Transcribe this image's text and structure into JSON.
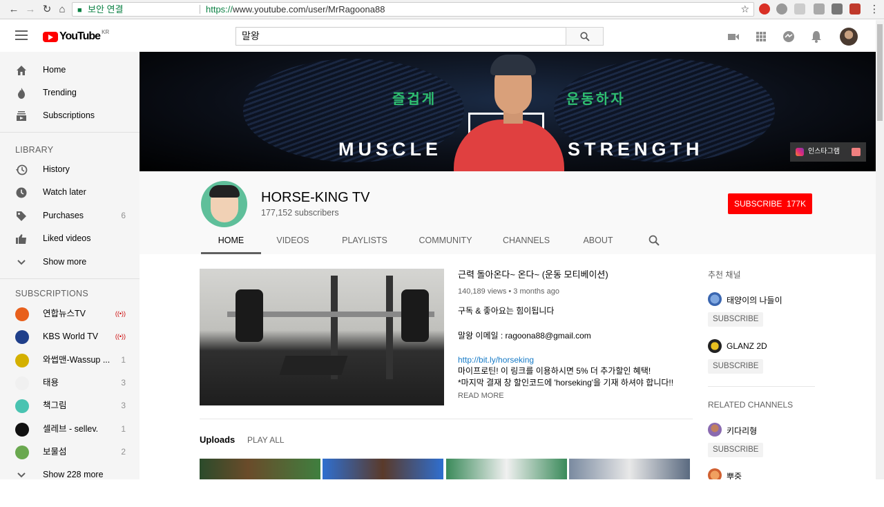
{
  "browser": {
    "security_label": "보안 연결",
    "url_scheme": "https://",
    "url_rest": "www.youtube.com/user/MrRagoona88"
  },
  "header": {
    "logo_text": "YouTube",
    "logo_region": "KR",
    "search_value": "말왕"
  },
  "sidebar": {
    "nav": [
      {
        "label": "Home",
        "icon": "home-icon"
      },
      {
        "label": "Trending",
        "icon": "flame-icon"
      },
      {
        "label": "Subscriptions",
        "icon": "subscriptions-icon"
      }
    ],
    "library_title": "LIBRARY",
    "library": [
      {
        "label": "History",
        "icon": "history-icon",
        "count": ""
      },
      {
        "label": "Watch later",
        "icon": "clock-icon",
        "count": ""
      },
      {
        "label": "Purchases",
        "icon": "tag-icon",
        "count": "6"
      },
      {
        "label": "Liked videos",
        "icon": "thumbs-up-icon",
        "count": ""
      },
      {
        "label": "Show more",
        "icon": "chevron-down-icon",
        "count": ""
      }
    ],
    "subscriptions_title": "SUBSCRIPTIONS",
    "subscriptions": [
      {
        "label": "연합뉴스TV",
        "count": "",
        "live": true,
        "color": "#e8601c"
      },
      {
        "label": "KBS World TV",
        "count": "",
        "live": true,
        "color": "#1f3f8a"
      },
      {
        "label": "와썹맨-Wassup ...",
        "count": "1",
        "live": false,
        "color": "#d4b000"
      },
      {
        "label": "태용",
        "count": "3",
        "live": false,
        "color": "#f0f0f0"
      },
      {
        "label": "책그림",
        "count": "3",
        "live": false,
        "color": "#49c3b1"
      },
      {
        "label": "셀레브 - sellev.",
        "count": "1",
        "live": false,
        "color": "#111111"
      },
      {
        "label": "보물섬",
        "count": "2",
        "live": false,
        "color": "#6aa84f"
      }
    ],
    "show_more_subs": "Show 228 more"
  },
  "banner": {
    "green_left": "즐겁게",
    "green_right": "운동하자",
    "white_left": "MUSCLE",
    "white_right": "STRENGTH",
    "insta_label": "인스타그램"
  },
  "channel": {
    "name": "HORSE-KING TV",
    "subscribers": "177,152 subscribers",
    "subscribe_label": "SUBSCRIBE",
    "subscribe_count": "177K",
    "tabs": [
      "HOME",
      "VIDEOS",
      "PLAYLISTS",
      "COMMUNITY",
      "CHANNELS",
      "ABOUT"
    ]
  },
  "featured": {
    "title": "근력 돌아온다~ 온다~ (운동 모티베이션)",
    "meta": "140,189 views • 3 months ago",
    "line1": "구독 & 좋아요는 힘이됩니다",
    "line2": "말왕 이메일 : ragoona88@gmail.com",
    "link": "http://bit.ly/horseking",
    "line3": "마이프로틴! 이 링크를 이용하시면 5% 더 추가할인 혜택!",
    "line4": "*마지막 결재 창 할인코드에 'horseking'을 기재 하셔야 합니다!!",
    "read_more": "READ MORE"
  },
  "uploads": {
    "title": "Uploads",
    "play_all": "PLAY ALL"
  },
  "right_column": {
    "recommended_title": "추천 채널",
    "recommended": [
      {
        "name": "태양이의 나들이",
        "subscribe": "SUBSCRIBE"
      },
      {
        "name": "GLANZ 2D",
        "subscribe": "SUBSCRIBE"
      }
    ],
    "related_title": "RELATED CHANNELS",
    "related": [
      {
        "name": "키다리형",
        "subscribe": "SUBSCRIBE"
      },
      {
        "name": "뿌중",
        "subscribe": ""
      }
    ]
  }
}
